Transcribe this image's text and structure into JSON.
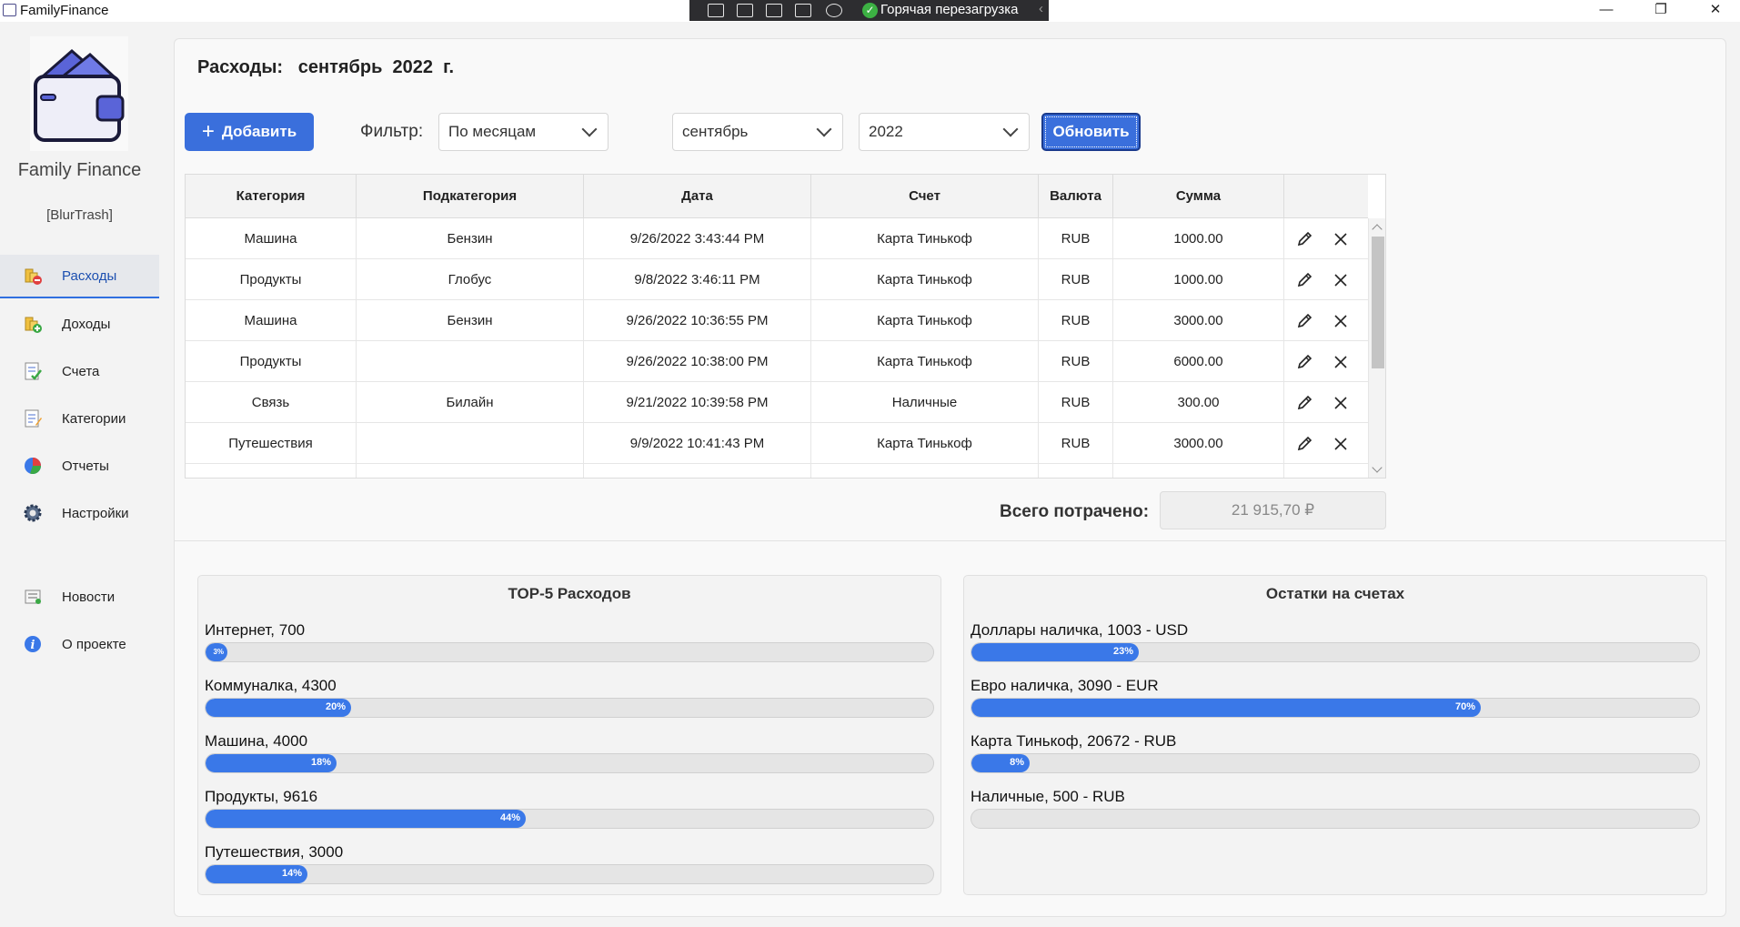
{
  "window": {
    "app_title": "FamilyFinance",
    "minimize": "—",
    "maximize": "❐",
    "close": "✕"
  },
  "debug_toolbar": {
    "hot_reload_label": "Горячая перезагрузка",
    "icons": [
      "select-element-icon",
      "pointer-icon",
      "layout-adorner-icon",
      "track-focus-icon",
      "binding-failures-icon"
    ]
  },
  "sidebar": {
    "brand": "Family Finance",
    "user": "[BlurTrash]",
    "items": [
      {
        "label": "Расходы",
        "icon": "expenses-icon",
        "active": true
      },
      {
        "label": "Доходы",
        "icon": "income-icon",
        "active": false
      },
      {
        "label": "Счета",
        "icon": "accounts-icon",
        "active": false
      },
      {
        "label": "Категории",
        "icon": "categories-icon",
        "active": false
      },
      {
        "label": "Отчеты",
        "icon": "reports-icon",
        "active": false
      },
      {
        "label": "Настройки",
        "icon": "settings-icon",
        "active": false
      },
      {
        "label": "Новости",
        "icon": "news-icon",
        "active": false
      },
      {
        "label": "О проекте",
        "icon": "info-icon",
        "active": false
      }
    ]
  },
  "header": {
    "title": "Расходы:   сентябрь  2022  г."
  },
  "toolbar": {
    "add_plus": "+",
    "add_label": "Добавить",
    "filter_label": "Фильтр:",
    "filter_mode": "По месяцам",
    "month": "сентябрь",
    "year": "2022",
    "refresh_label": "Обновить"
  },
  "table": {
    "columns": [
      "Категория",
      "Подкатегория",
      "Дата",
      "Счет",
      "Валюта",
      "Сумма"
    ],
    "rows": [
      {
        "category": "Машина",
        "subcategory": "Бензин",
        "date": "9/26/2022 3:43:44 PM",
        "account": "Карта Тинькоф",
        "currency": "RUB",
        "amount": "1000.00"
      },
      {
        "category": "Продукты",
        "subcategory": "Глобус",
        "date": "9/8/2022 3:46:11 PM",
        "account": "Карта Тинькоф",
        "currency": "RUB",
        "amount": "1000.00"
      },
      {
        "category": "Машина",
        "subcategory": "Бензин",
        "date": "9/26/2022 10:36:55 PM",
        "account": "Карта Тинькоф",
        "currency": "RUB",
        "amount": "3000.00"
      },
      {
        "category": "Продукты",
        "subcategory": "",
        "date": "9/26/2022 10:38:00 PM",
        "account": "Карта Тинькоф",
        "currency": "RUB",
        "amount": "6000.00"
      },
      {
        "category": "Связь",
        "subcategory": "Билайн",
        "date": "9/21/2022 10:39:58 PM",
        "account": "Наличные",
        "currency": "RUB",
        "amount": "300.00"
      },
      {
        "category": "Путешествия",
        "subcategory": "",
        "date": "9/9/2022 10:41:43 PM",
        "account": "Карта Тинькоф",
        "currency": "RUB",
        "amount": "3000.00"
      }
    ]
  },
  "summary": {
    "total_label": "Всего потрачено:",
    "total_value": "21 915,70 ₽"
  },
  "top5": {
    "title": "TOP-5 Расходов",
    "items": [
      {
        "label": "Интернет, 700",
        "percent": 3,
        "percent_label": "3%"
      },
      {
        "label": "Коммуналка, 4300",
        "percent": 20,
        "percent_label": "20%"
      },
      {
        "label": "Машина, 4000",
        "percent": 18,
        "percent_label": "18%"
      },
      {
        "label": "Продукты, 9616",
        "percent": 44,
        "percent_label": "44%"
      },
      {
        "label": "Путешествия, 3000",
        "percent": 14,
        "percent_label": "14%"
      }
    ]
  },
  "balances": {
    "title": "Остатки на счетах",
    "items": [
      {
        "label": "Доллары наличка, 1003 - USD",
        "percent": 23,
        "percent_label": "23%"
      },
      {
        "label": "Евро наличка, 3090 - EUR",
        "percent": 70,
        "percent_label": "70%"
      },
      {
        "label": "Карта Тинькоф, 20672 - RUB",
        "percent": 8,
        "percent_label": "8%"
      },
      {
        "label": "Наличные, 500 - RUB",
        "percent": 0,
        "percent_label": ""
      }
    ]
  },
  "colors": {
    "accent": "#3a6fdc",
    "progress": "#3a78e8"
  }
}
